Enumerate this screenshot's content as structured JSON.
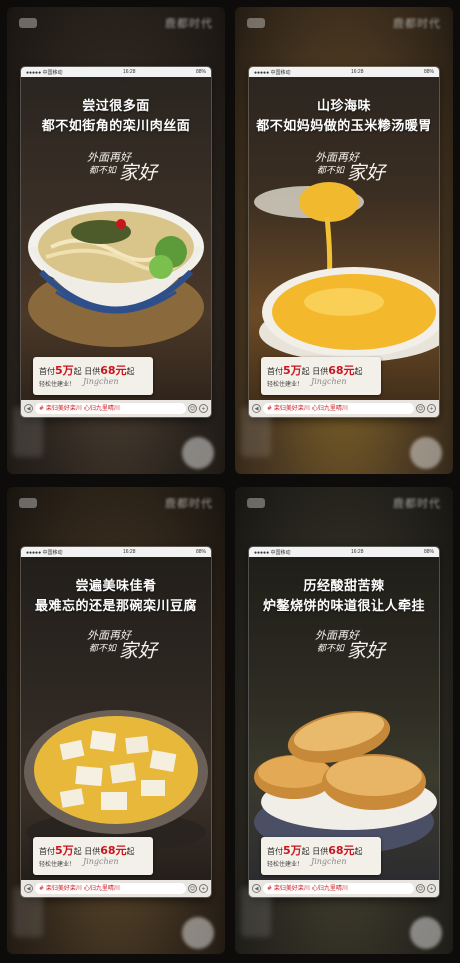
{
  "status_bar": {
    "carrier": "●●●●● 中国移动",
    "wifi": "令",
    "time": "16:28",
    "battery": "88%"
  },
  "brand_logo": "鹿都时代",
  "calligraphy": {
    "line1": "外面再好",
    "line2": "都不如",
    "line3": "家好"
  },
  "price_box": {
    "prefix": "首付",
    "down": "5万",
    "mid": "起 日供",
    "daily": "68元",
    "suffix": "起",
    "slogan": "轻松住建业！",
    "signature": "Jingchen"
  },
  "bottom_field": "# 栾归美好栾川  心归九里晴川",
  "icons": {
    "left": "speaker-icon",
    "right1": "emoji-icon",
    "right2": "plus-icon"
  },
  "cards": [
    {
      "line1": "尝过很多面",
      "line2": "都不如街角的栾川肉丝面",
      "food": "noodle-bowl"
    },
    {
      "line1": "山珍海味",
      "line2": "都不如妈妈做的玉米糁汤暖胃",
      "food": "corn-soup"
    },
    {
      "line1": "尝遍美味佳肴",
      "line2": "最难忘的还是那碗栾川豆腐",
      "food": "tofu-pot"
    },
    {
      "line1": "历经酸甜苦辣",
      "line2": "炉鏊烧饼的味道很让人牵挂",
      "food": "baked-cakes"
    }
  ],
  "colors": {
    "accent": "#c8161d",
    "bg": "#0e0c0b"
  }
}
